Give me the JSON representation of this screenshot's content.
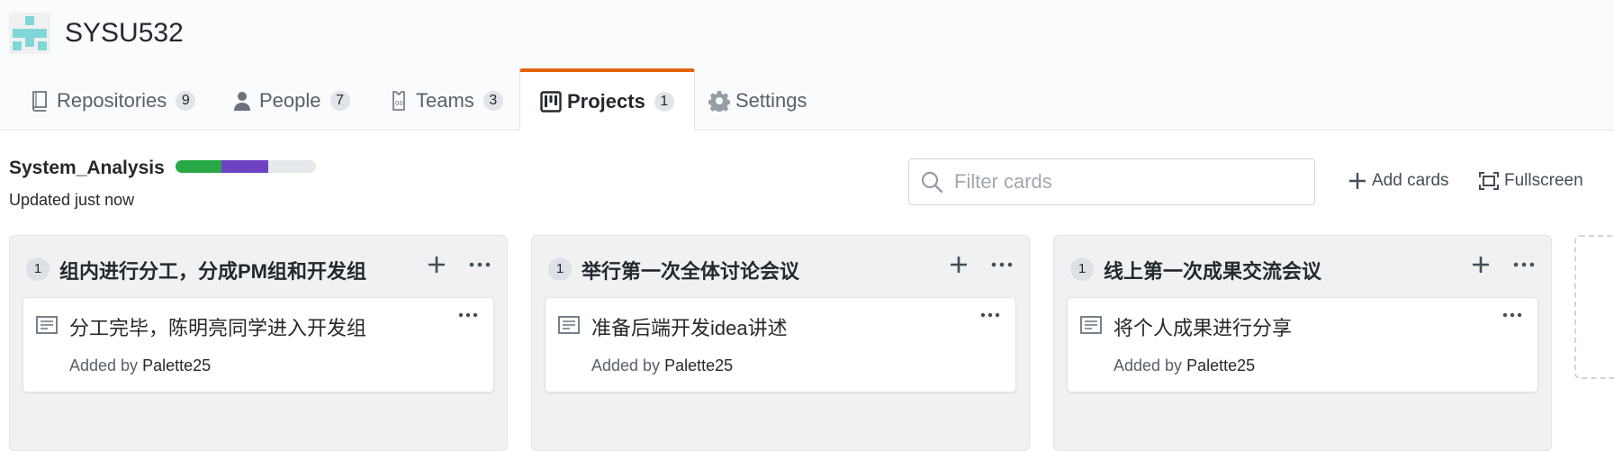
{
  "org": {
    "name": "SYSU532",
    "avatar_colors": [
      "#7fd7d7",
      "#ffffff"
    ]
  },
  "nav": {
    "tabs": [
      {
        "label": "Repositories",
        "count": "9",
        "icon": "repo-icon"
      },
      {
        "label": "People",
        "count": "7",
        "icon": "person-icon"
      },
      {
        "label": "Teams",
        "count": "3",
        "icon": "jersey-icon"
      },
      {
        "label": "Projects",
        "count": "1",
        "icon": "project-icon",
        "selected": true
      },
      {
        "label": "Settings",
        "count": "",
        "icon": "gear-icon"
      }
    ],
    "selected_accent": "#e36209"
  },
  "project": {
    "name": "System_Analysis",
    "updated": "Updated just now",
    "progress": [
      {
        "status": "done",
        "fraction": 0.33,
        "color": "#28a745"
      },
      {
        "status": "in_progress",
        "fraction": 0.33,
        "color": "#6f42c1"
      },
      {
        "status": "todo",
        "fraction": 0.34,
        "color": "#e6e9ec"
      }
    ]
  },
  "toolbar": {
    "filter_placeholder": "Filter cards",
    "add_cards_label": "Add cards",
    "fullscreen_label": "Fullscreen"
  },
  "columns": [
    {
      "count": "1",
      "title": "组内进行分工，分成PM组和开发组",
      "cards": [
        {
          "title": "分工完毕，陈明亮同学进入开发组",
          "added_by_prefix": "Added by",
          "author": "Palette25"
        }
      ]
    },
    {
      "count": "1",
      "title": "举行第一次全体讨论会议",
      "cards": [
        {
          "title": "准备后端开发idea讲述",
          "added_by_prefix": "Added by",
          "author": "Palette25"
        }
      ]
    },
    {
      "count": "1",
      "title": "线上第一次成果交流会议",
      "cards": [
        {
          "title": "将个人成果进行分享",
          "added_by_prefix": "Added by",
          "author": "Palette25"
        }
      ]
    }
  ]
}
